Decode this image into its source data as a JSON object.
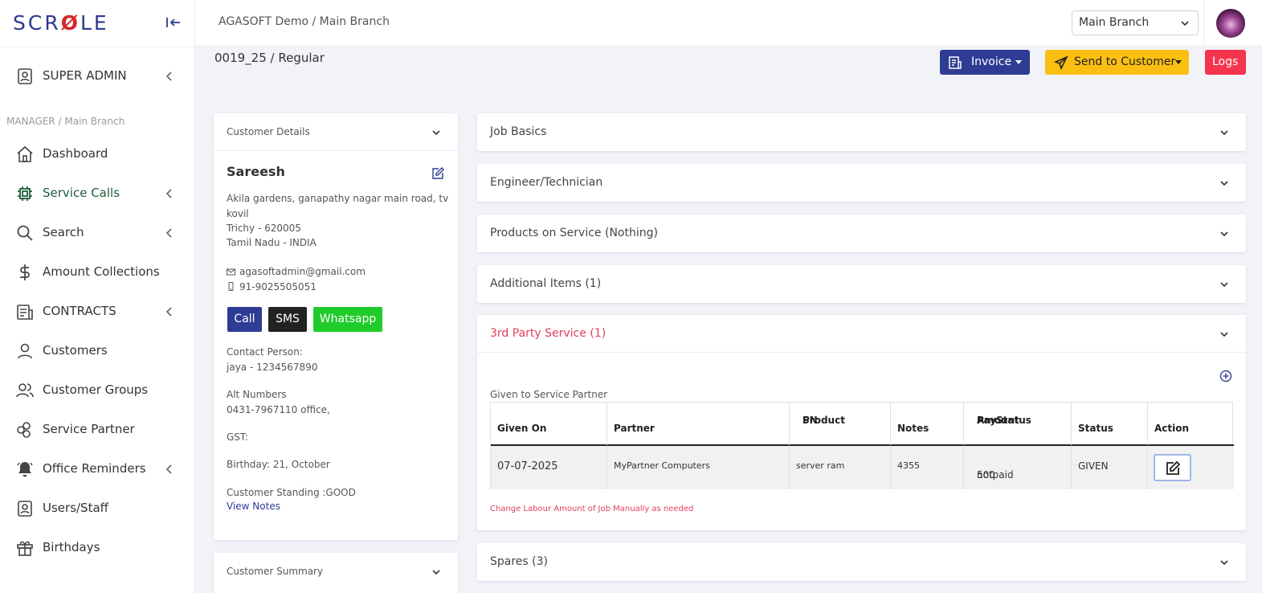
{
  "sidebar": {
    "logo": {
      "pre": "SCR",
      "mid": "Ø",
      "post": "LE"
    },
    "super_admin": "SUPER ADMIN",
    "section_label": "MANAGER / Main Branch",
    "items": [
      {
        "label": "Dashboard",
        "icon": "home-icon"
      },
      {
        "label": "Service Calls",
        "icon": "cpu-icon",
        "active": true
      },
      {
        "label": "Search",
        "icon": "search-icon"
      },
      {
        "label": "Amount Collections",
        "icon": "dollar-icon"
      },
      {
        "label": "CONTRACTS",
        "icon": "contract-icon"
      },
      {
        "label": "Customers",
        "icon": "user-icon"
      },
      {
        "label": "Customer Groups",
        "icon": "users-icon"
      },
      {
        "label": "Service Partner",
        "icon": "partner-icon"
      },
      {
        "label": "Office Reminders",
        "icon": "bell-icon"
      },
      {
        "label": "Users/Staff",
        "icon": "staff-icon"
      },
      {
        "label": "Birthdays",
        "icon": "gift-icon"
      }
    ]
  },
  "topbar": {
    "breadcrumb": "AGASOFT Demo / Main Branch",
    "branch_select": "Main Branch"
  },
  "job": {
    "title": "0019_25 / Regular",
    "invoice_label": "Invoice",
    "send_label": "Send to Customer",
    "logs_label": "Logs"
  },
  "customer": {
    "header": "Customer Details",
    "name": "Sareesh",
    "address_1": "Akila gardens, ganapathy nagar main road, tv",
    "address_2": "kovil",
    "address_3": "Trichy - 620005",
    "address_4": "Tamil Nadu - INDIA",
    "email": "agasoftadmin@gmail.com",
    "phone": "91-9025505051",
    "call_label": "Call",
    "sms_label": "SMS",
    "whatsapp_label": "Whatsapp",
    "contact_person_label": "Contact Person:",
    "contact_person": "jaya - 1234567890",
    "alt_numbers_label": "Alt Numbers",
    "alt_numbers": "0431-7967110 office,",
    "gst": "GST:",
    "birthday": "Birthday: 21, October",
    "standing": "Customer Standing :GOOD",
    "view_notes": "View Notes",
    "summary_header": "Customer Summary"
  },
  "sections": {
    "job_basics": "Job Basics",
    "engineer": "Engineer/Technician",
    "products": "Products on Service (Nothing)",
    "additional": "Additional Items (1)",
    "third_party": "3rd Party Service (1)",
    "spares": "Spares (3)"
  },
  "third_party": {
    "given_label": "Given to Service Partner",
    "columns": {
      "given_on": "Given On",
      "partner": "Partner",
      "product_1": "Product",
      "product_2": "SN",
      "notes": "Notes",
      "amount_1": "Amount",
      "amount_2": "PayStatus",
      "status": "Status",
      "action": "Action"
    },
    "row": {
      "given_on": "07-07-2025",
      "partner": "MyPartner Computers",
      "product": "server ram",
      "notes": "4355",
      "amount": "500",
      "pay_status": "notpaid",
      "status": "GIVEN"
    },
    "warning": "Change Labour Amount of Job Manually as needed"
  },
  "colors": {
    "primary": "#2f3c94",
    "warning": "#fbbf11",
    "danger": "#f5344d",
    "whatsapp": "#1fcc2a",
    "sms": "#222222",
    "accent_red": "#e04059",
    "active_nav": "#1d5c3a"
  }
}
